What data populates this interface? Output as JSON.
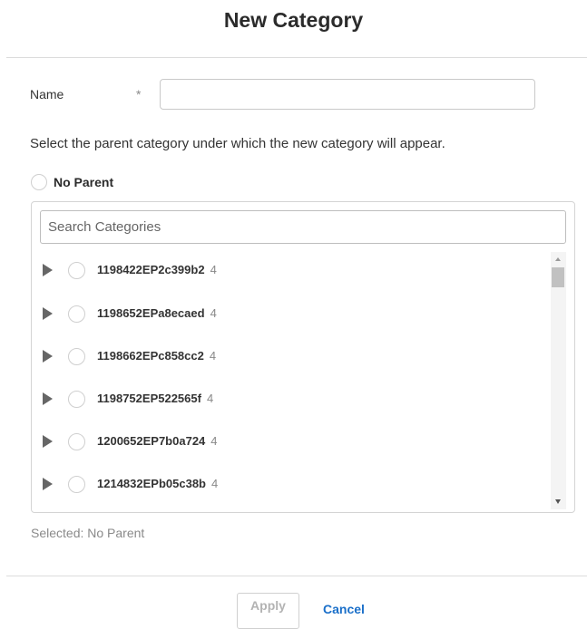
{
  "dialog": {
    "title": "New Category"
  },
  "name_field": {
    "label": "Name",
    "required_mark": "*",
    "value": "",
    "placeholder": ""
  },
  "instruction": "Select the parent category under which the new category will appear.",
  "no_parent": {
    "label": "No Parent",
    "selected": false
  },
  "search": {
    "placeholder": "Search Categories",
    "value": ""
  },
  "categories": [
    {
      "name": "1198422EP2c399b2",
      "count": "4"
    },
    {
      "name": "1198652EPa8ecaed",
      "count": "4"
    },
    {
      "name": "1198662EPc858cc2",
      "count": "4"
    },
    {
      "name": "1198752EP522565f",
      "count": "4"
    },
    {
      "name": "1200652EP7b0a724",
      "count": "4"
    },
    {
      "name": "1214832EPb05c38b",
      "count": "4"
    }
  ],
  "selected_status": "Selected: No Parent",
  "footer": {
    "apply_label": "Apply",
    "cancel_label": "Cancel"
  },
  "colors": {
    "cancel_link": "#1a6fc9",
    "apply_disabled_text": "#b3b3b3",
    "divider": "#dcdcdc"
  }
}
